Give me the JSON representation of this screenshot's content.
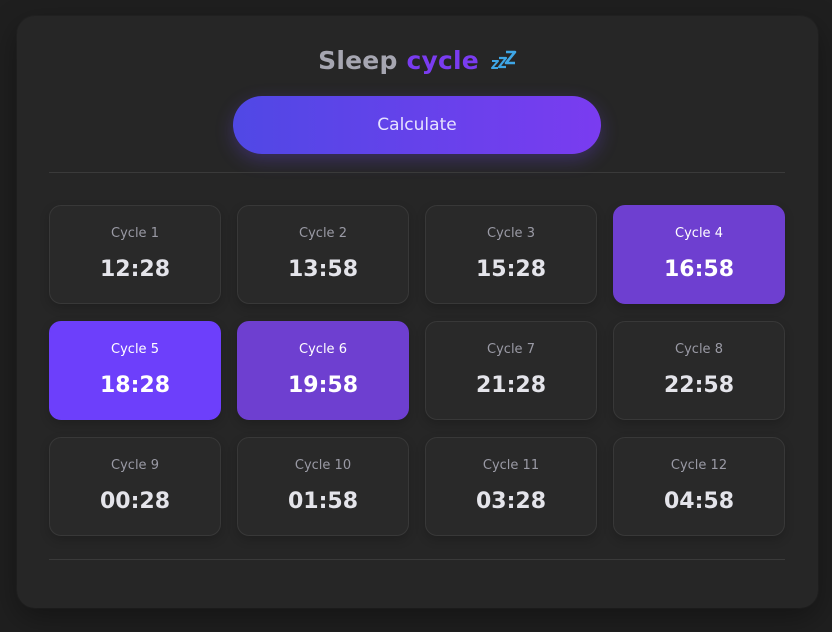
{
  "title": {
    "word1": "Sleep",
    "word2": "cycle",
    "icon": "zzz-icon"
  },
  "calculate_button": {
    "label": "Calculate"
  },
  "colors": {
    "accent_gradient_start": "#5048e5",
    "accent_gradient_end": "#7a3cf0",
    "highlight_recommended": "#6e3fd0",
    "highlight_best": "#6d3ffb"
  },
  "cycles": [
    {
      "label": "Cycle 1",
      "time": "12:28",
      "highlight": ""
    },
    {
      "label": "Cycle 2",
      "time": "13:58",
      "highlight": ""
    },
    {
      "label": "Cycle 3",
      "time": "15:28",
      "highlight": ""
    },
    {
      "label": "Cycle 4",
      "time": "16:58",
      "highlight": "hl1"
    },
    {
      "label": "Cycle 5",
      "time": "18:28",
      "highlight": "hl2"
    },
    {
      "label": "Cycle 6",
      "time": "19:58",
      "highlight": "hl1"
    },
    {
      "label": "Cycle 7",
      "time": "21:28",
      "highlight": ""
    },
    {
      "label": "Cycle 8",
      "time": "22:58",
      "highlight": ""
    },
    {
      "label": "Cycle 9",
      "time": "00:28",
      "highlight": ""
    },
    {
      "label": "Cycle 10",
      "time": "01:58",
      "highlight": ""
    },
    {
      "label": "Cycle 11",
      "time": "03:28",
      "highlight": ""
    },
    {
      "label": "Cycle 12",
      "time": "04:58",
      "highlight": ""
    }
  ]
}
